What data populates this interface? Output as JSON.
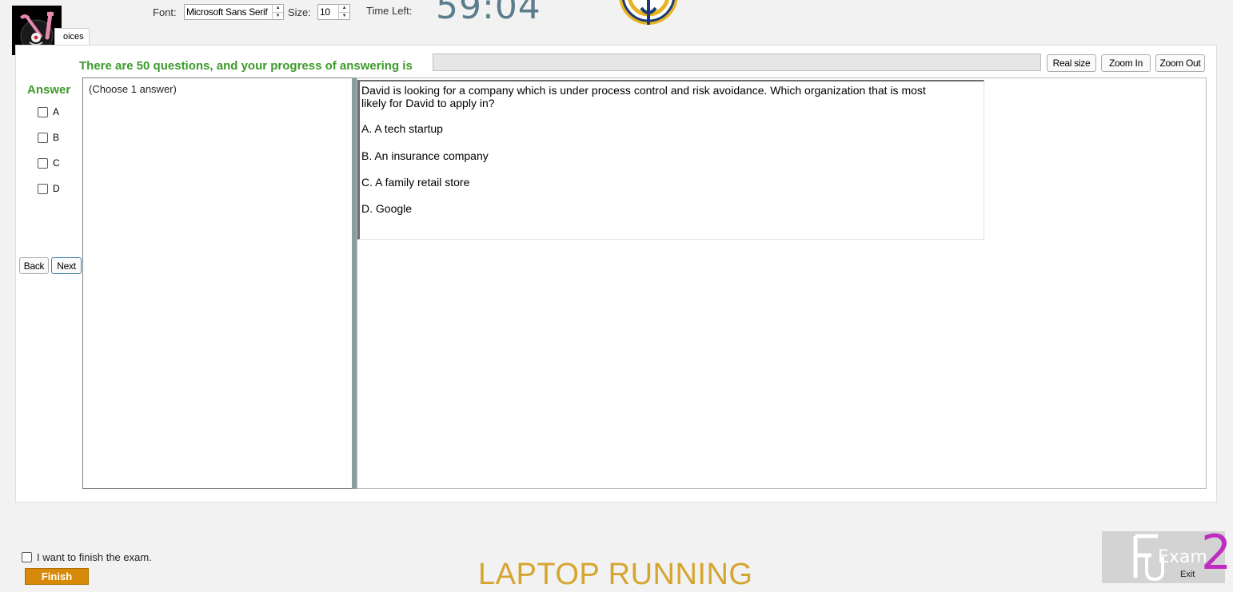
{
  "toolbar": {
    "font_label": "Font:",
    "font_value": "Microsoft Sans Serif",
    "size_label": "Size:",
    "size_value": "10",
    "time_left_label": "Time Left:",
    "timer": "59:04"
  },
  "tab": {
    "label": "oices"
  },
  "progress": {
    "title": "There are 50 questions, and your progress of answering is",
    "value_percent": 0
  },
  "zoom": {
    "real_size": "Real size",
    "zoom_in": "Zoom In",
    "zoom_out": "Zoom Out"
  },
  "answer": {
    "title": "Answer",
    "options": [
      "A",
      "B",
      "C",
      "D"
    ],
    "hint": "(Choose 1 answer)"
  },
  "nav": {
    "back": "Back",
    "next": "Next"
  },
  "question": {
    "text": "David is looking for a company which is under process control and risk avoidance. Which organization that is most likely for David to apply in?",
    "options": [
      "A.  A tech startup",
      "B.  An insurance company",
      "C.  A family retail store",
      "D.  Google"
    ]
  },
  "footer": {
    "finish_checkbox_label": "I want to finish the exam.",
    "finish_button": "Finish",
    "status_text": "LAPTOP RUNNING",
    "brand_exam": "Exam",
    "brand_number": "2",
    "exit_label": "Exit"
  },
  "colors": {
    "accent_green": "#3c9a2b",
    "timer": "#5a7d8c",
    "finish_button": "#d78a0a",
    "status_text": "#d6a530",
    "brand_number": "#c02cc0"
  }
}
